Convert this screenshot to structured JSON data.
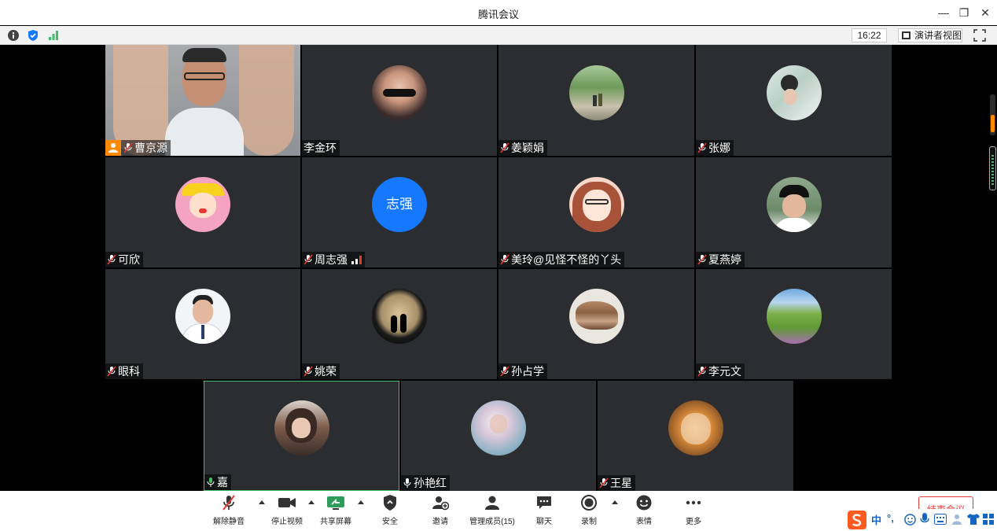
{
  "window": {
    "title": "腾讯会议"
  },
  "infobar": {
    "time": "16:22",
    "view_label": "演讲者视图"
  },
  "participants": [
    {
      "name": "曹京源",
      "host": true,
      "mic": "muted"
    },
    {
      "name": "李金环",
      "mic": "none"
    },
    {
      "name": "姜颖娟",
      "mic": "muted"
    },
    {
      "name": "张娜",
      "mic": "muted"
    },
    {
      "name": "可欣",
      "mic": "muted"
    },
    {
      "name": "周志强",
      "mic": "muted",
      "avatar_text": "志强",
      "signal": true
    },
    {
      "name": "美玲@见怪不怪的丫头",
      "mic": "muted"
    },
    {
      "name": "夏燕婷",
      "mic": "muted"
    },
    {
      "name": "眼科",
      "mic": "muted"
    },
    {
      "name": "姚荣",
      "mic": "muted"
    },
    {
      "name": "孙占学",
      "mic": "muted"
    },
    {
      "name": "李元文",
      "mic": "muted"
    },
    {
      "name": "嘉",
      "mic": "active"
    },
    {
      "name": "孙艳红",
      "mic": "on"
    },
    {
      "name": "王星",
      "mic": "muted"
    }
  ],
  "toolbar": {
    "unmute": "解除静音",
    "stop_video": "停止视频",
    "share_screen": "共享屏幕",
    "security": "安全",
    "invite": "邀请",
    "manage_members": "管理成员(15)",
    "chat": "聊天",
    "record": "录制",
    "reactions": "表情",
    "more": "更多",
    "end_meeting": "结束会议"
  },
  "ime": {
    "mode": "中"
  },
  "colors": {
    "host_badge": "#ff8a00",
    "muted_red": "#e53935",
    "active_green": "#3fbf6a",
    "avatar_blue": "#1677ff"
  }
}
